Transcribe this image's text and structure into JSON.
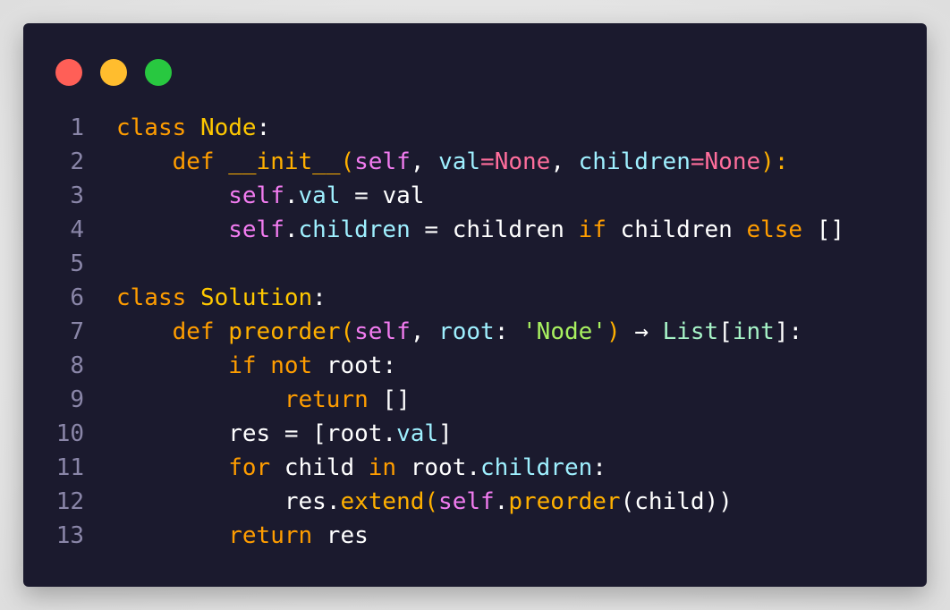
{
  "window": {
    "controls": [
      {
        "name": "close",
        "color": "#ff5f57"
      },
      {
        "name": "minimize",
        "color": "#ffbd2e"
      },
      {
        "name": "zoom",
        "color": "#28c840"
      }
    ]
  },
  "code": {
    "line_numbers": [
      "1",
      "2",
      "3",
      "4",
      "5",
      "6",
      "7",
      "8",
      "9",
      "10",
      "11",
      "12",
      "13"
    ],
    "tokens": {
      "l1": [
        "class",
        "Node",
        ":"
      ],
      "l2": [
        "    ",
        "def",
        " ",
        "__init__",
        "(",
        "self",
        ", ",
        "val",
        "=",
        "None",
        ", ",
        "children",
        "=",
        "None",
        "):"
      ],
      "l3": [
        "        ",
        "self",
        ".",
        "val",
        " = val"
      ],
      "l4": [
        "        ",
        "self",
        ".",
        "children",
        " = children ",
        "if",
        " children ",
        "else",
        " []"
      ],
      "l6": [
        "class",
        "Solution",
        ":"
      ],
      "l7": [
        "    ",
        "def",
        " ",
        "preorder",
        "(",
        "self",
        ", ",
        "root",
        ": ",
        "'Node'",
        ") ",
        "→",
        " ",
        "List",
        "[",
        "int",
        "]:"
      ],
      "l8": [
        "        ",
        "if",
        " ",
        "not",
        " root:"
      ],
      "l9": [
        "            ",
        "return",
        " []"
      ],
      "l10": [
        "        ",
        "res = [root",
        ".",
        "val",
        "]"
      ],
      "l11": [
        "        ",
        "for",
        " child ",
        "in",
        " root",
        ".",
        "children",
        ":"
      ],
      "l12": [
        "            ",
        "res",
        ".",
        "extend",
        "(",
        "self",
        ".",
        "preorder",
        "(child))"
      ],
      "l13": [
        "        ",
        "return",
        " res"
      ]
    }
  }
}
